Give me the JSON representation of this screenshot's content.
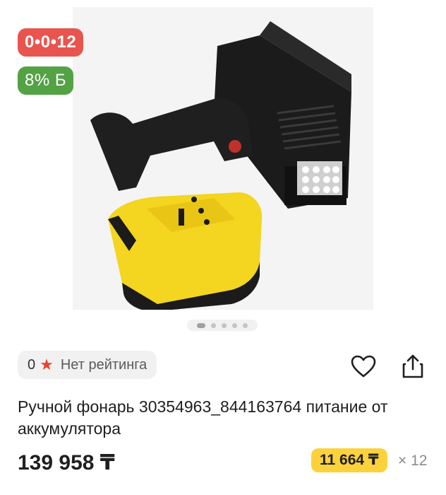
{
  "badges": {
    "timer": "0•0•12",
    "discount": "8% Б"
  },
  "gallery": {
    "image_alt": "handheld-led-flashlight-with-yellow-battery",
    "dots_count": 5,
    "active_dot": 0
  },
  "rating": {
    "value": "0",
    "label": "Нет рейтинга"
  },
  "actions": {
    "favorite_icon": "heart-icon",
    "share_icon": "share-icon"
  },
  "product": {
    "title": "Ручной фонарь 30354963_844163764 питание от аккумулятора",
    "price": "139 958 ₸",
    "installment_price": "11 664 ₸",
    "installment_multiplier": "× 12"
  },
  "colors": {
    "timer_badge": "#e8554e",
    "discount_badge": "#53a244",
    "installment_badge": "#fbd23c",
    "star": "#e8432f"
  }
}
